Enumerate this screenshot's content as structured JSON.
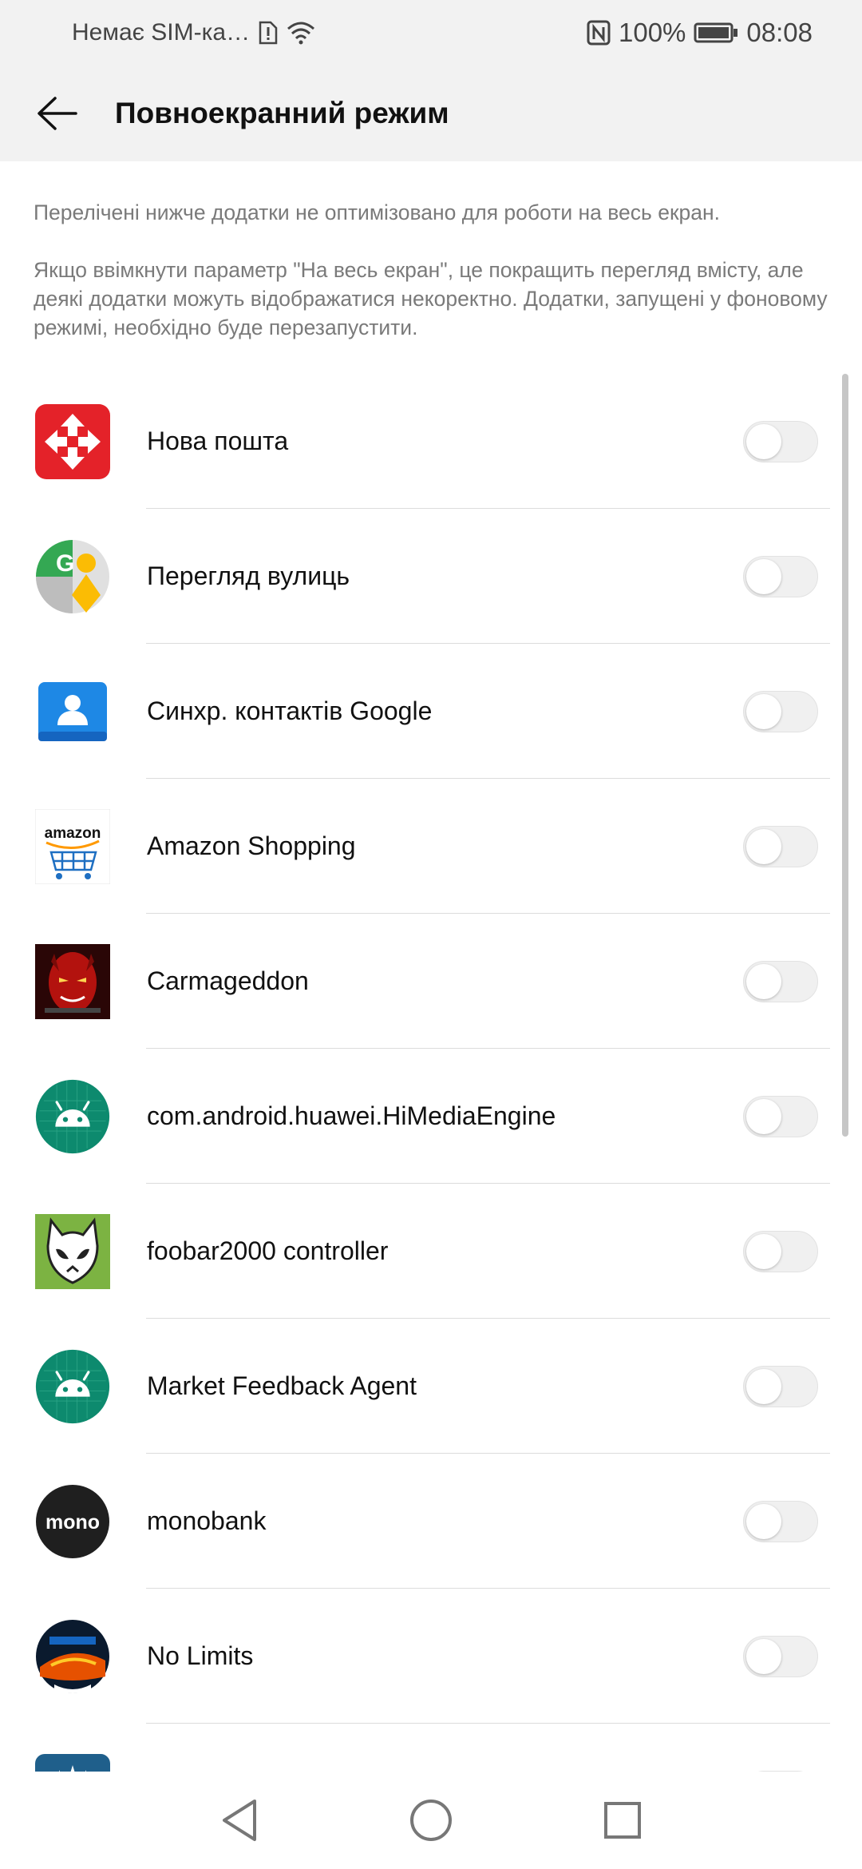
{
  "statusbar": {
    "carrier": "Немає SIM-ка…",
    "battery": "100%",
    "time": "08:08"
  },
  "appbar": {
    "title": "Повноекранний режим"
  },
  "description": {
    "line1": "Перелічені нижче додатки не оптимізовано для роботи на весь екран.",
    "line2": "Якщо ввімкнути параметр \"На весь екран\", це покращить перегляд вмісту, але деякі додатки можуть відображатися некоректно. Додатки, запущені у фоновому режимі, необхідно буде перезапустити."
  },
  "apps": [
    {
      "name": "Нова пошта",
      "icon": "nova-poshta-icon",
      "enabled": false
    },
    {
      "name": "Перегляд вулиць",
      "icon": "street-view-icon",
      "enabled": false
    },
    {
      "name": "Синхр. контактів Google",
      "icon": "google-contacts-sync-icon",
      "enabled": false
    },
    {
      "name": "Amazon Shopping",
      "icon": "amazon-icon",
      "icon_text": "amazon",
      "enabled": false
    },
    {
      "name": "Carmageddon",
      "icon": "carmageddon-icon",
      "enabled": false
    },
    {
      "name": "com.android.huawei.HiMediaEngine",
      "icon": "android-icon",
      "enabled": false
    },
    {
      "name": "foobar2000 controller",
      "icon": "foobar-alien-icon",
      "enabled": false
    },
    {
      "name": "Market Feedback Agent",
      "icon": "android-icon",
      "enabled": false
    },
    {
      "name": "monobank",
      "icon": "monobank-icon",
      "icon_text": "mono",
      "enabled": false
    },
    {
      "name": "No Limits",
      "icon": "no-limits-icon",
      "enabled": false
    }
  ],
  "colors": {
    "nova_red": "#e42229",
    "android_green": "#0d8a6e",
    "mono_black": "#1f1f1f",
    "contacts_blue": "#1e88e5",
    "foobar_green": "#7cb342"
  }
}
